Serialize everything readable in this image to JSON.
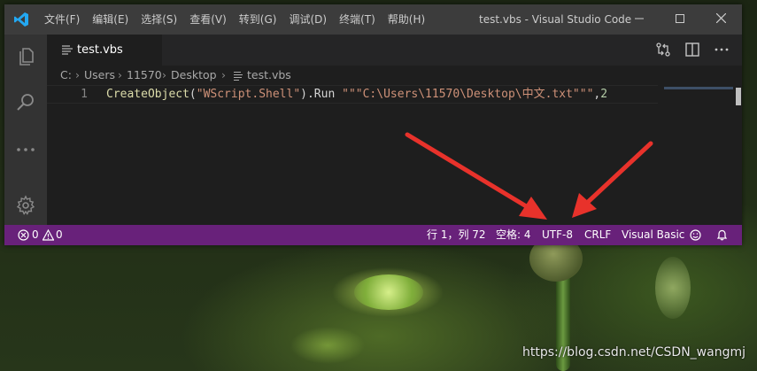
{
  "window_title": "test.vbs - Visual Studio Code",
  "menu": [
    "文件(F)",
    "编辑(E)",
    "选择(S)",
    "查看(V)",
    "转到(G)",
    "调试(D)",
    "终端(T)",
    "帮助(H)"
  ],
  "tab": {
    "label": "test.vbs"
  },
  "breadcrumb": [
    "C:",
    "Users",
    "11570",
    "Desktop",
    "test.vbs"
  ],
  "editor": {
    "line_number": "1",
    "tokens": {
      "fn": "CreateObject",
      "p1": "(",
      "s1": "\"WScript.Shell\"",
      "p2": ").Run ",
      "s2": "\"\"\"C:\\Users\\11570\\Desktop\\中文.txt\"\"\"",
      "p3": ",",
      "n1": "2"
    }
  },
  "statusbar": {
    "errors": "0",
    "warnings": "0",
    "position": "行 1，列 72",
    "spaces": "空格: 4",
    "encoding": "UTF-8",
    "eol": "CRLF",
    "language": "Visual Basic"
  },
  "watermark": "https://blog.csdn.net/CSDN_wangmj",
  "colors": {
    "statusbar": "#68217a",
    "titlebar": "#3c3c3c",
    "arrow": "#e8322b"
  }
}
